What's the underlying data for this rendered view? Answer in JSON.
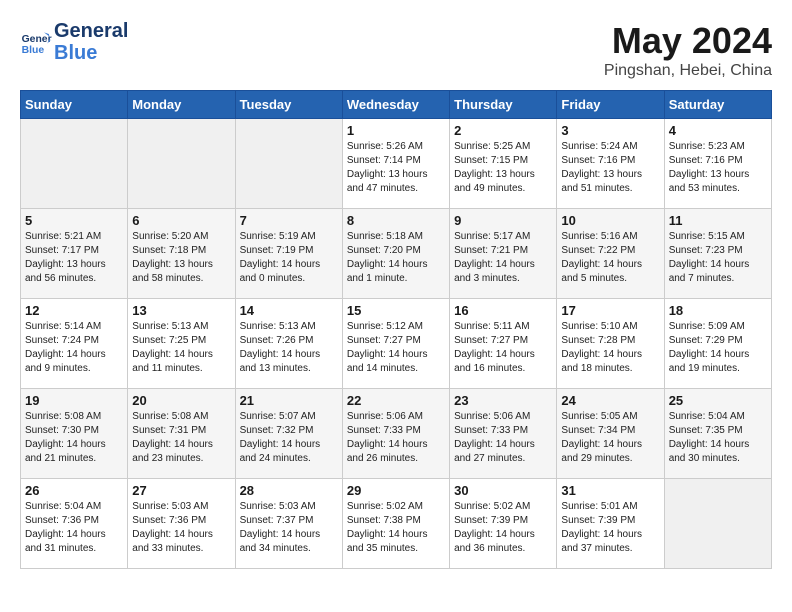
{
  "logo": {
    "name": "General",
    "name2": "Blue"
  },
  "title": "May 2024",
  "subtitle": "Pingshan, Hebei, China",
  "days_of_week": [
    "Sunday",
    "Monday",
    "Tuesday",
    "Wednesday",
    "Thursday",
    "Friday",
    "Saturday"
  ],
  "weeks": [
    {
      "days": [
        {
          "num": "",
          "info": ""
        },
        {
          "num": "",
          "info": ""
        },
        {
          "num": "",
          "info": ""
        },
        {
          "num": "1",
          "info": "Sunrise: 5:26 AM\nSunset: 7:14 PM\nDaylight: 13 hours\nand 47 minutes."
        },
        {
          "num": "2",
          "info": "Sunrise: 5:25 AM\nSunset: 7:15 PM\nDaylight: 13 hours\nand 49 minutes."
        },
        {
          "num": "3",
          "info": "Sunrise: 5:24 AM\nSunset: 7:16 PM\nDaylight: 13 hours\nand 51 minutes."
        },
        {
          "num": "4",
          "info": "Sunrise: 5:23 AM\nSunset: 7:16 PM\nDaylight: 13 hours\nand 53 minutes."
        }
      ]
    },
    {
      "days": [
        {
          "num": "5",
          "info": "Sunrise: 5:21 AM\nSunset: 7:17 PM\nDaylight: 13 hours\nand 56 minutes."
        },
        {
          "num": "6",
          "info": "Sunrise: 5:20 AM\nSunset: 7:18 PM\nDaylight: 13 hours\nand 58 minutes."
        },
        {
          "num": "7",
          "info": "Sunrise: 5:19 AM\nSunset: 7:19 PM\nDaylight: 14 hours\nand 0 minutes."
        },
        {
          "num": "8",
          "info": "Sunrise: 5:18 AM\nSunset: 7:20 PM\nDaylight: 14 hours\nand 1 minute."
        },
        {
          "num": "9",
          "info": "Sunrise: 5:17 AM\nSunset: 7:21 PM\nDaylight: 14 hours\nand 3 minutes."
        },
        {
          "num": "10",
          "info": "Sunrise: 5:16 AM\nSunset: 7:22 PM\nDaylight: 14 hours\nand 5 minutes."
        },
        {
          "num": "11",
          "info": "Sunrise: 5:15 AM\nSunset: 7:23 PM\nDaylight: 14 hours\nand 7 minutes."
        }
      ]
    },
    {
      "days": [
        {
          "num": "12",
          "info": "Sunrise: 5:14 AM\nSunset: 7:24 PM\nDaylight: 14 hours\nand 9 minutes."
        },
        {
          "num": "13",
          "info": "Sunrise: 5:13 AM\nSunset: 7:25 PM\nDaylight: 14 hours\nand 11 minutes."
        },
        {
          "num": "14",
          "info": "Sunrise: 5:13 AM\nSunset: 7:26 PM\nDaylight: 14 hours\nand 13 minutes."
        },
        {
          "num": "15",
          "info": "Sunrise: 5:12 AM\nSunset: 7:27 PM\nDaylight: 14 hours\nand 14 minutes."
        },
        {
          "num": "16",
          "info": "Sunrise: 5:11 AM\nSunset: 7:27 PM\nDaylight: 14 hours\nand 16 minutes."
        },
        {
          "num": "17",
          "info": "Sunrise: 5:10 AM\nSunset: 7:28 PM\nDaylight: 14 hours\nand 18 minutes."
        },
        {
          "num": "18",
          "info": "Sunrise: 5:09 AM\nSunset: 7:29 PM\nDaylight: 14 hours\nand 19 minutes."
        }
      ]
    },
    {
      "days": [
        {
          "num": "19",
          "info": "Sunrise: 5:08 AM\nSunset: 7:30 PM\nDaylight: 14 hours\nand 21 minutes."
        },
        {
          "num": "20",
          "info": "Sunrise: 5:08 AM\nSunset: 7:31 PM\nDaylight: 14 hours\nand 23 minutes."
        },
        {
          "num": "21",
          "info": "Sunrise: 5:07 AM\nSunset: 7:32 PM\nDaylight: 14 hours\nand 24 minutes."
        },
        {
          "num": "22",
          "info": "Sunrise: 5:06 AM\nSunset: 7:33 PM\nDaylight: 14 hours\nand 26 minutes."
        },
        {
          "num": "23",
          "info": "Sunrise: 5:06 AM\nSunset: 7:33 PM\nDaylight: 14 hours\nand 27 minutes."
        },
        {
          "num": "24",
          "info": "Sunrise: 5:05 AM\nSunset: 7:34 PM\nDaylight: 14 hours\nand 29 minutes."
        },
        {
          "num": "25",
          "info": "Sunrise: 5:04 AM\nSunset: 7:35 PM\nDaylight: 14 hours\nand 30 minutes."
        }
      ]
    },
    {
      "days": [
        {
          "num": "26",
          "info": "Sunrise: 5:04 AM\nSunset: 7:36 PM\nDaylight: 14 hours\nand 31 minutes."
        },
        {
          "num": "27",
          "info": "Sunrise: 5:03 AM\nSunset: 7:36 PM\nDaylight: 14 hours\nand 33 minutes."
        },
        {
          "num": "28",
          "info": "Sunrise: 5:03 AM\nSunset: 7:37 PM\nDaylight: 14 hours\nand 34 minutes."
        },
        {
          "num": "29",
          "info": "Sunrise: 5:02 AM\nSunset: 7:38 PM\nDaylight: 14 hours\nand 35 minutes."
        },
        {
          "num": "30",
          "info": "Sunrise: 5:02 AM\nSunset: 7:39 PM\nDaylight: 14 hours\nand 36 minutes."
        },
        {
          "num": "31",
          "info": "Sunrise: 5:01 AM\nSunset: 7:39 PM\nDaylight: 14 hours\nand 37 minutes."
        },
        {
          "num": "",
          "info": ""
        }
      ]
    }
  ]
}
